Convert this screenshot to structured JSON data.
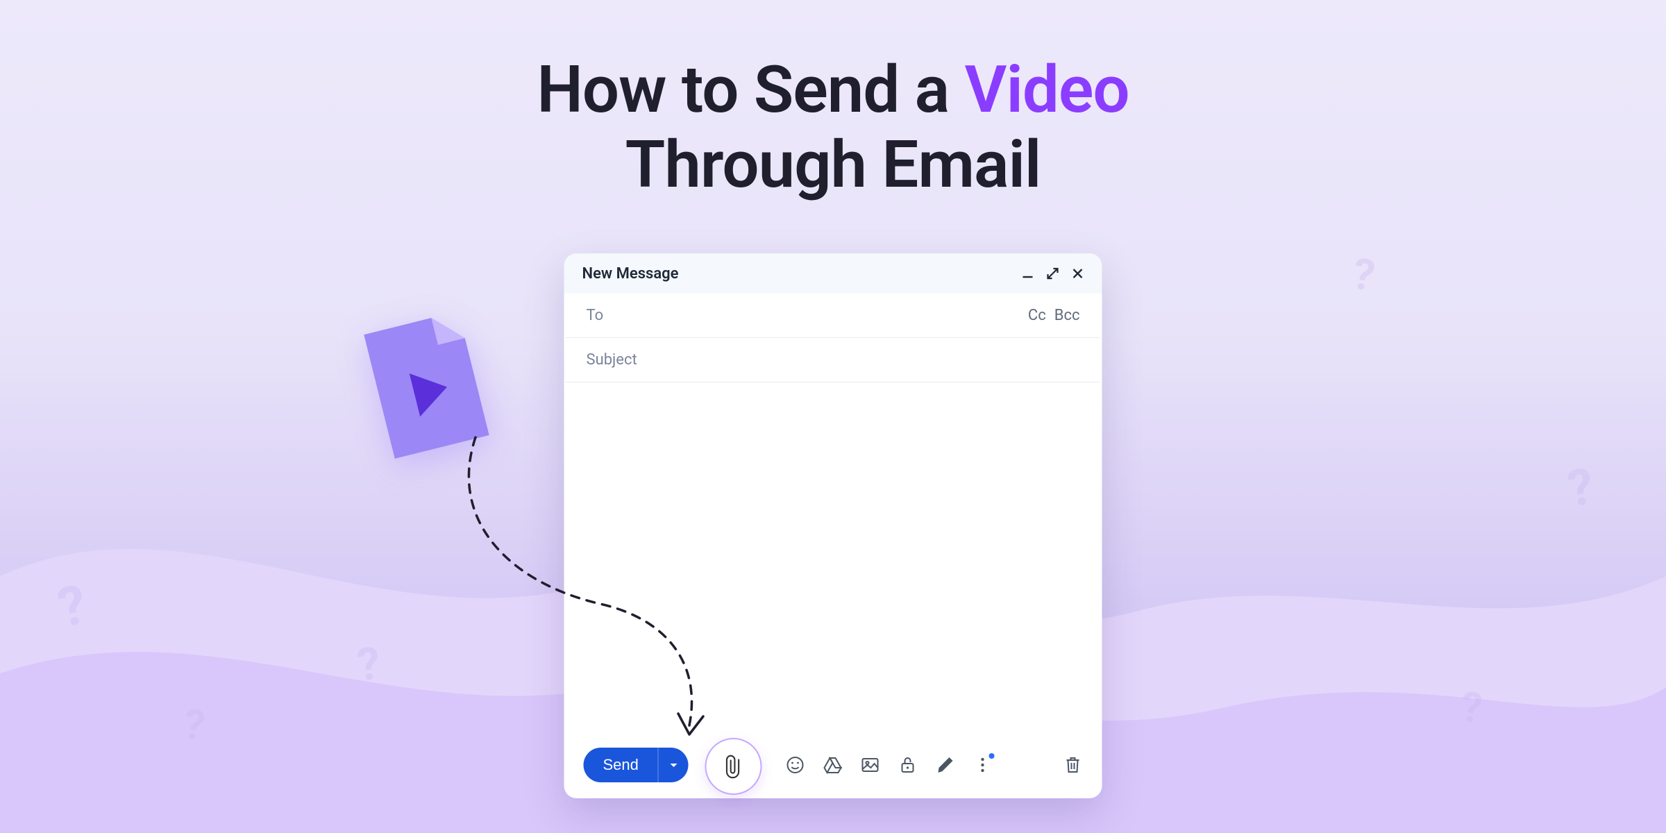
{
  "headline": {
    "part1": "How to Send a ",
    "accent": "Video",
    "part2": "Through Email"
  },
  "compose": {
    "title": "New Message",
    "to_label": "To",
    "cc_label": "Cc",
    "bcc_label": "Bcc",
    "subject_label": "Subject",
    "send_label": "Send"
  }
}
